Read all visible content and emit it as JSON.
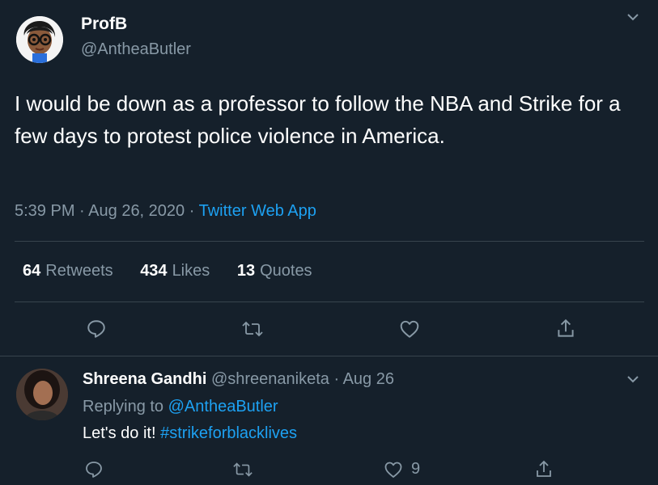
{
  "tweet": {
    "display_name": "ProfB",
    "handle": "@AntheaButler",
    "text": "I would be down as a professor to follow the NBA and Strike for a few days to protest police violence in America.",
    "time": "5:39 PM",
    "date": "Aug 26, 2020",
    "separator": "·",
    "app": "Twitter Web App",
    "stats": {
      "retweets_count": "64",
      "retweets_label": "Retweets",
      "likes_count": "434",
      "likes_label": "Likes",
      "quotes_count": "13",
      "quotes_label": "Quotes"
    }
  },
  "reply": {
    "display_name": "Shreena Gandhi",
    "handle": "@shreenaniketa",
    "separator": "·",
    "date": "Aug 26",
    "replying_prefix": "Replying to",
    "replying_to": "@AntheaButler",
    "text_plain": "Let's do it!",
    "hashtag": "#strikeforblacklives",
    "like_count": "9"
  },
  "icons": {
    "reply": "reply-icon",
    "retweet": "retweet-icon",
    "like": "heart-icon",
    "share": "share-icon",
    "more": "chevron-down-icon"
  },
  "colors": {
    "background": "#15202b",
    "accent": "#1da1f2",
    "secondary_text": "#8899a6",
    "divider": "#38444d"
  }
}
